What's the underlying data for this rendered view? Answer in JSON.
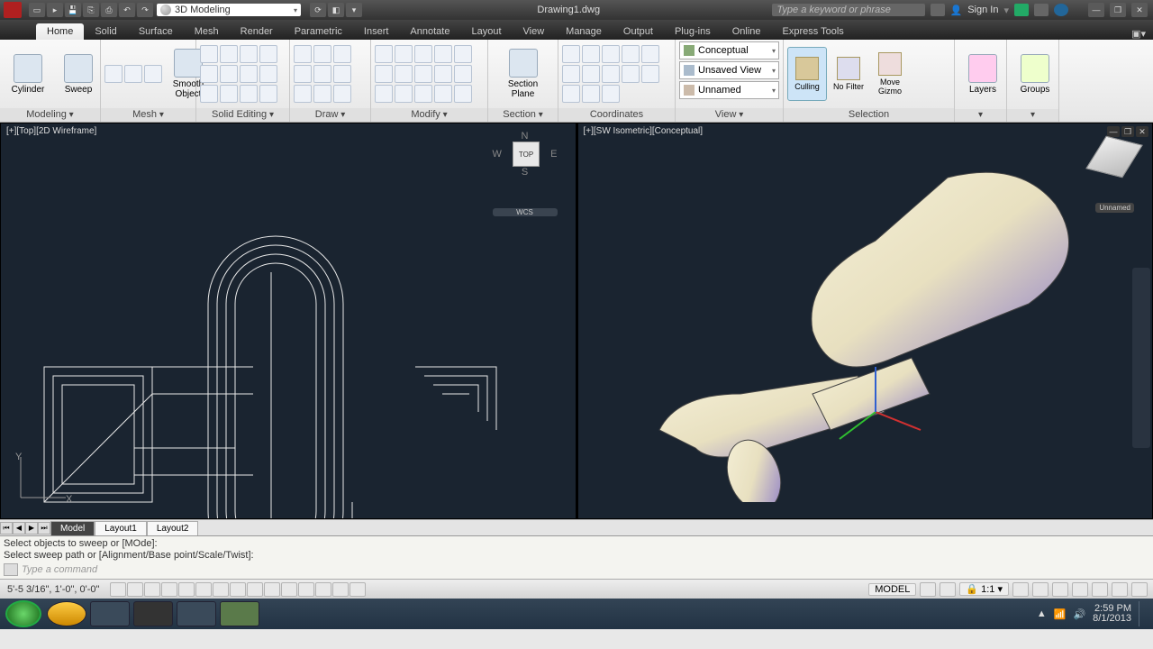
{
  "app": {
    "workspace": "3D Modeling",
    "title": "Drawing1.dwg",
    "search_ph": "Type a keyword or phrase",
    "signin": "Sign In"
  },
  "tabs": [
    "Home",
    "Solid",
    "Surface",
    "Mesh",
    "Render",
    "Parametric",
    "Insert",
    "Annotate",
    "Layout",
    "View",
    "Manage",
    "Output",
    "Plug-ins",
    "Online",
    "Express Tools"
  ],
  "ribbon": {
    "modeling": {
      "btn1": "Cylinder",
      "btn2": "Sweep",
      "title": "Modeling"
    },
    "mesh": {
      "btn": "Smooth Object",
      "title": "Mesh"
    },
    "solid_editing": {
      "title": "Solid Editing"
    },
    "draw": {
      "title": "Draw"
    },
    "modify": {
      "title": "Modify"
    },
    "section": {
      "btn": "Section Plane",
      "title": "Section"
    },
    "coords": {
      "title": "Coordinates"
    },
    "view": {
      "visual": "Conceptual",
      "saved": "Unsaved View",
      "ucs": "Unnamed",
      "title": "View"
    },
    "selection": {
      "culling": "Culling",
      "filter": "No Filter",
      "gizmo": "Move Gizmo",
      "title": "Selection"
    },
    "layers": {
      "btn": "Layers"
    },
    "groups": {
      "btn": "Groups"
    }
  },
  "vp_left": {
    "label": "[+][Top][2D Wireframe]",
    "cube": "TOP",
    "wcs": "WCS",
    "n": "N",
    "s": "S",
    "e": "E",
    "w": "W"
  },
  "vp_right": {
    "label": "[+][SW Isometric][Conceptual]",
    "unnamed": "Unnamed"
  },
  "layout_tabs": {
    "model": "Model",
    "l1": "Layout1",
    "l2": "Layout2"
  },
  "cmd": {
    "h1": "Select objects to sweep or [MOde]:",
    "h2": "Select sweep path or [Alignment/Base point/Scale/Twist]:",
    "ph": "Type a command"
  },
  "status": {
    "coord1": "5'-5 3/16\", 1'-0\"",
    "coord2": ", 0'-0\"",
    "model": "MODEL",
    "scale": "1:1"
  },
  "tray": {
    "time": "2:59 PM",
    "date": "8/1/2013"
  }
}
